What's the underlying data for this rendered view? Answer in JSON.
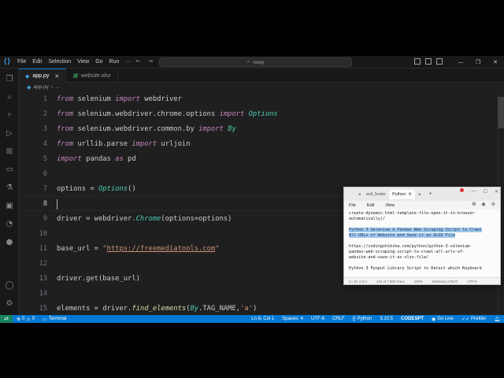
{
  "app": {
    "menus": [
      "File",
      "Edit",
      "Selection",
      "View",
      "Go",
      "Run"
    ],
    "menu_more": "···",
    "search_text": "rewp"
  },
  "tabs": [
    {
      "label": "app.py",
      "type": "py",
      "active": true
    },
    {
      "label": "website.xlsx",
      "type": "xlsx",
      "active": false
    }
  ],
  "breadcrumb": {
    "file": "app.py",
    "more": "..."
  },
  "editor": {
    "lines": [
      {
        "n": "1",
        "html": "<span class=\"kw\">from</span> selenium <span class=\"kw\">import</span> webdriver"
      },
      {
        "n": "2",
        "html": "<span class=\"kw\">from</span> selenium.webdriver.chrome.options <span class=\"kw\">import</span> <span class=\"cls\">Options</span>"
      },
      {
        "n": "3",
        "html": "<span class=\"kw\">from</span> selenium.webdriver.common.by <span class=\"kw\">import</span> <span class=\"cls\">By</span>"
      },
      {
        "n": "4",
        "html": "<span class=\"kw\">from</span> urllib.parse <span class=\"kw\">import</span> urljoin"
      },
      {
        "n": "5",
        "html": "<span class=\"kw\">import</span> pandas <span class=\"kw\">as</span> pd"
      },
      {
        "n": "6",
        "html": ""
      },
      {
        "n": "7",
        "html": "options = <span class=\"cls\">Options</span>()"
      },
      {
        "n": "8",
        "html": "",
        "current": true
      },
      {
        "n": "9",
        "html": "driver = webdriver.<span class=\"cls\">Chrome</span>(options=options)"
      },
      {
        "n": "10",
        "html": ""
      },
      {
        "n": "11",
        "html": "base_url = <span class=\"str\">\"</span><span class=\"url\">https://freemediatools.com</span><span class=\"str\">\"</span>"
      },
      {
        "n": "12",
        "html": ""
      },
      {
        "n": "13",
        "html": "driver.get(base_url)"
      },
      {
        "n": "14",
        "html": ""
      },
      {
        "n": "15",
        "html": "elements = driver.<span class=\"fn\">find_elements</span>(<span class=\"cls\">By</span>.TAG_NAME,<span class=\"str\">'a'</span>)"
      }
    ]
  },
  "statusbar": {
    "errors": "0",
    "warnings": "0",
    "terminal": "Terminal",
    "position": "Ln 8, Col 1",
    "spaces": "Spaces: 4",
    "encoding": "UTF-8",
    "eol": "CRLF",
    "language": "Python",
    "version": "3.10.5",
    "codesnap": "CODESPT",
    "golive": "Go Live",
    "prettier": "Prettier"
  },
  "notepad": {
    "tabs": [
      "sell_footer",
      "Python"
    ],
    "add_tab": "+",
    "menus": [
      "File",
      "Edit",
      "View"
    ],
    "lines": [
      {
        "text": "create-dynamic-html-template-file-open-it-in-browser-",
        "style": "plain"
      },
      {
        "text": "automatically)/",
        "style": "plain"
      },
      {
        "text": "",
        "style": "gap"
      },
      {
        "text": "Python 3 Selenium & Pandas Web Scraping Script to Crawl",
        "style": "sel"
      },
      {
        "text": "All URLs of Website and Save it as XLSX File",
        "style": "sel"
      },
      {
        "text": "",
        "style": "gap"
      },
      {
        "text": "https://codingshiksha.com/python/python-3-selenium-",
        "style": "plain"
      },
      {
        "text": "pandas-web-scraping-script-to-crawl-all-urls-of-",
        "style": "plain"
      },
      {
        "text": "website-and-save-it-as-xlsx-file/",
        "style": "plain"
      },
      {
        "text": "",
        "style": "gap"
      },
      {
        "text": "Python 3 Pynput Library Script to Detect which Keyboard",
        "style": "plain"
      }
    ],
    "status": {
      "position": "Ln 10, Col 1",
      "chars": "101 of 7,690 chars",
      "zoom": "100%",
      "eol": "Windows (CRLF)",
      "encoding": "UTF-8"
    }
  }
}
